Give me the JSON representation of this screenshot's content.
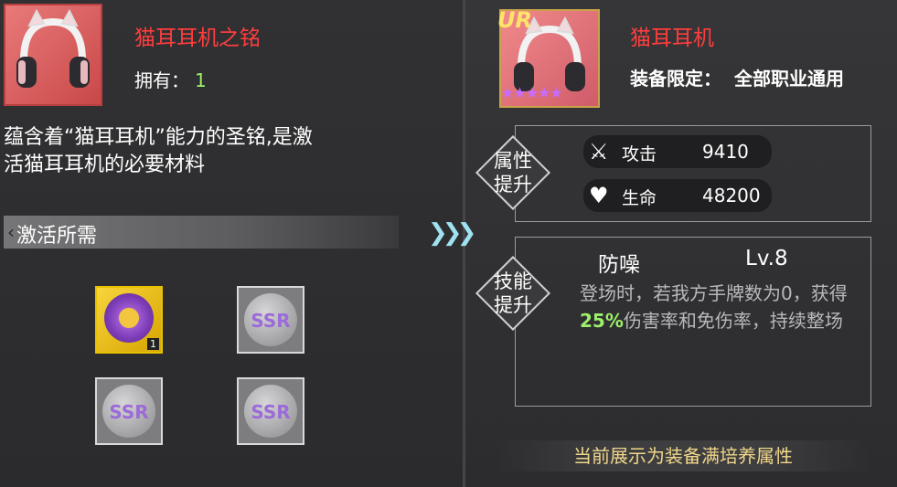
{
  "left": {
    "item_title": "猫耳耳机之铭",
    "owned_label": "拥有：",
    "owned_value": "1",
    "description_line1": "蕴含着“猫耳耳机”能力的圣铭,是激",
    "description_line2": "活猫耳耳机的必要材料",
    "requirements_title": "激活所需",
    "materials": [
      {
        "type": "item",
        "count": "1",
        "icon": "purple-ring-icon"
      },
      {
        "type": "ssr",
        "label": "SSR",
        "icon": "ssr-medal-icon"
      },
      {
        "type": "ssr",
        "label": "SSR",
        "icon": "ssr-medal-icon"
      },
      {
        "type": "ssr",
        "label": "SSR",
        "icon": "ssr-medal-icon"
      }
    ]
  },
  "right": {
    "rarity": "UR",
    "stars": "★★★★★",
    "item_title": "猫耳耳机",
    "equip_label": "装备限定：",
    "equip_value": "全部职业通用",
    "attr_header_line1": "属性",
    "attr_header_line2": "提升",
    "stats": [
      {
        "icon": "crossed-swords-icon",
        "name": "攻击",
        "value": "9410"
      },
      {
        "icon": "heart-icon",
        "name": "生命",
        "value": "48200"
      }
    ],
    "skill_header_line1": "技能",
    "skill_header_line2": "提升",
    "skill": {
      "name": "防噪",
      "level": "Lv.8",
      "desc_part1": "登场时，若我方手牌数为0，获得",
      "desc_highlight": "25%",
      "desc_part2": "伤害率和免伤率，持续整场"
    },
    "footer_note": "当前展示为装备满培养属性"
  },
  "colors": {
    "title_red": "#ff3d3d",
    "highlight_green": "#9cf06a",
    "footer_gold": "#f0d78a"
  }
}
